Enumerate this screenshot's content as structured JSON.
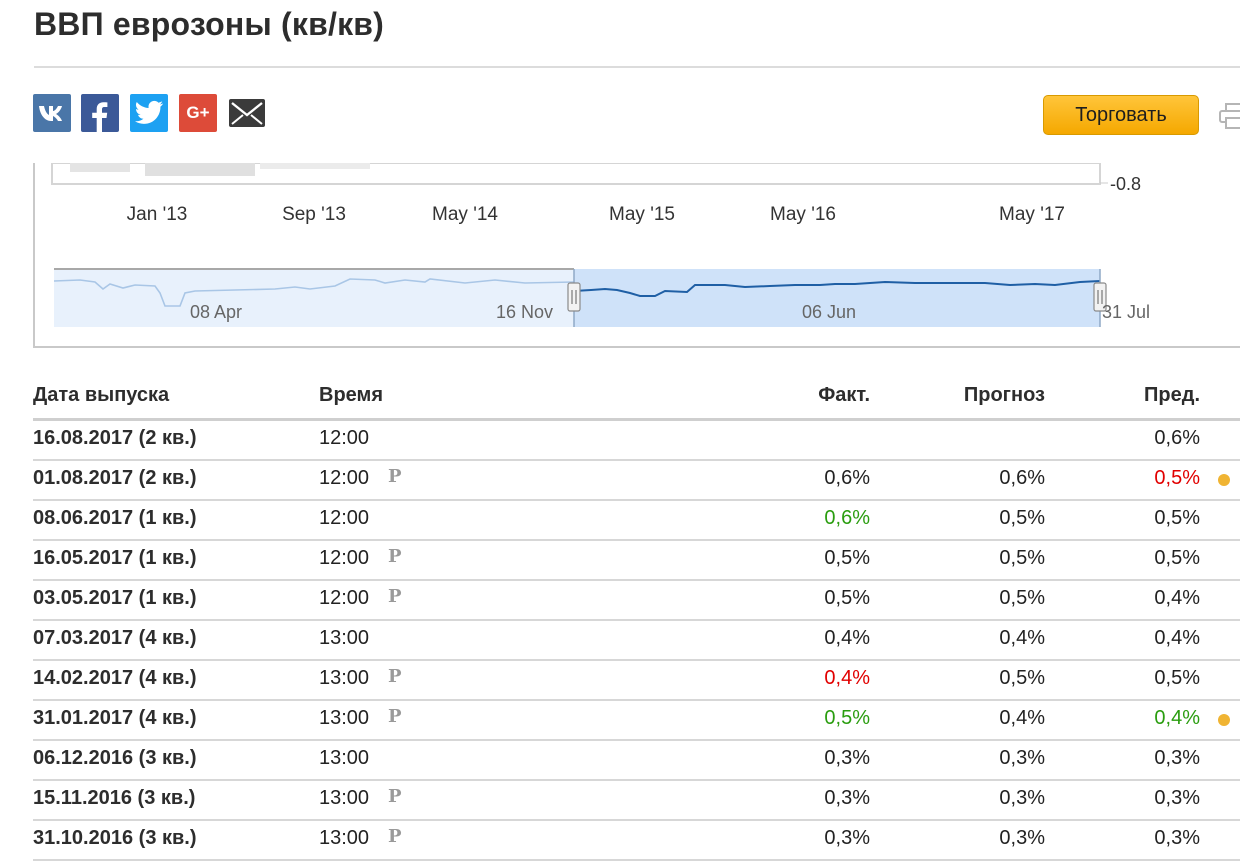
{
  "page": {
    "title": "ВВП еврозоны (кв/кв)"
  },
  "share": {
    "icons": [
      "vk-icon",
      "facebook-icon",
      "twitter-icon",
      "google-plus-icon",
      "mail-icon"
    ],
    "google_plus_label": "G+"
  },
  "toolbar": {
    "trade_label": "Торговать"
  },
  "colors": {
    "positive": "#2a9d0f",
    "negative": "#e10000",
    "accent": "#f5a800",
    "chart_line": "#1f5fa5",
    "navigator_fill": "#cfe2f9"
  },
  "chart": {
    "y_tick_label": "-0.8",
    "x_ticks": [
      "Jan '13",
      "Sep '13",
      "May '14",
      "May '15",
      "May '16",
      "May '17"
    ],
    "navigator_ticks": [
      "08 Apr",
      "16 Nov",
      "06 Jun",
      "31 Jul"
    ]
  },
  "table": {
    "headers": {
      "date": "Дата выпуска",
      "time": "Время",
      "actual": "Факт.",
      "forecast": "Прогноз",
      "previous": "Пред."
    },
    "rows": [
      {
        "date": "16.08.2017 (2 кв.)",
        "time": "12:00",
        "prelim": "",
        "actual": "",
        "actual_state": "neu",
        "forecast": "",
        "previous": "0,6%",
        "previous_state": "neu",
        "dot": false
      },
      {
        "date": "01.08.2017 (2 кв.)",
        "time": "12:00",
        "prelim": "P",
        "actual": "0,6%",
        "actual_state": "neu",
        "forecast": "0,6%",
        "previous": "0,5%",
        "previous_state": "neg",
        "dot": true
      },
      {
        "date": "08.06.2017 (1 кв.)",
        "time": "12:00",
        "prelim": "",
        "actual": "0,6%",
        "actual_state": "pos",
        "forecast": "0,5%",
        "previous": "0,5%",
        "previous_state": "neu",
        "dot": false
      },
      {
        "date": "16.05.2017 (1 кв.)",
        "time": "12:00",
        "prelim": "P",
        "actual": "0,5%",
        "actual_state": "neu",
        "forecast": "0,5%",
        "previous": "0,5%",
        "previous_state": "neu",
        "dot": false
      },
      {
        "date": "03.05.2017 (1 кв.)",
        "time": "12:00",
        "prelim": "P",
        "actual": "0,5%",
        "actual_state": "neu",
        "forecast": "0,5%",
        "previous": "0,4%",
        "previous_state": "neu",
        "dot": false
      },
      {
        "date": "07.03.2017 (4 кв.)",
        "time": "13:00",
        "prelim": "",
        "actual": "0,4%",
        "actual_state": "neu",
        "forecast": "0,4%",
        "previous": "0,4%",
        "previous_state": "neu",
        "dot": false
      },
      {
        "date": "14.02.2017 (4 кв.)",
        "time": "13:00",
        "prelim": "P",
        "actual": "0,4%",
        "actual_state": "neg",
        "forecast": "0,5%",
        "previous": "0,5%",
        "previous_state": "neu",
        "dot": false
      },
      {
        "date": "31.01.2017 (4 кв.)",
        "time": "13:00",
        "prelim": "P",
        "actual": "0,5%",
        "actual_state": "pos",
        "forecast": "0,4%",
        "previous": "0,4%",
        "previous_state": "pos",
        "dot": true
      },
      {
        "date": "06.12.2016 (3 кв.)",
        "time": "13:00",
        "prelim": "",
        "actual": "0,3%",
        "actual_state": "neu",
        "forecast": "0,3%",
        "previous": "0,3%",
        "previous_state": "neu",
        "dot": false
      },
      {
        "date": "15.11.2016 (3 кв.)",
        "time": "13:00",
        "prelim": "P",
        "actual": "0,3%",
        "actual_state": "neu",
        "forecast": "0,3%",
        "previous": "0,3%",
        "previous_state": "neu",
        "dot": false
      },
      {
        "date": "31.10.2016 (3 кв.)",
        "time": "13:00",
        "prelim": "P",
        "actual": "0,3%",
        "actual_state": "neu",
        "forecast": "0,3%",
        "previous": "0,3%",
        "previous_state": "neu",
        "dot": false
      }
    ]
  }
}
